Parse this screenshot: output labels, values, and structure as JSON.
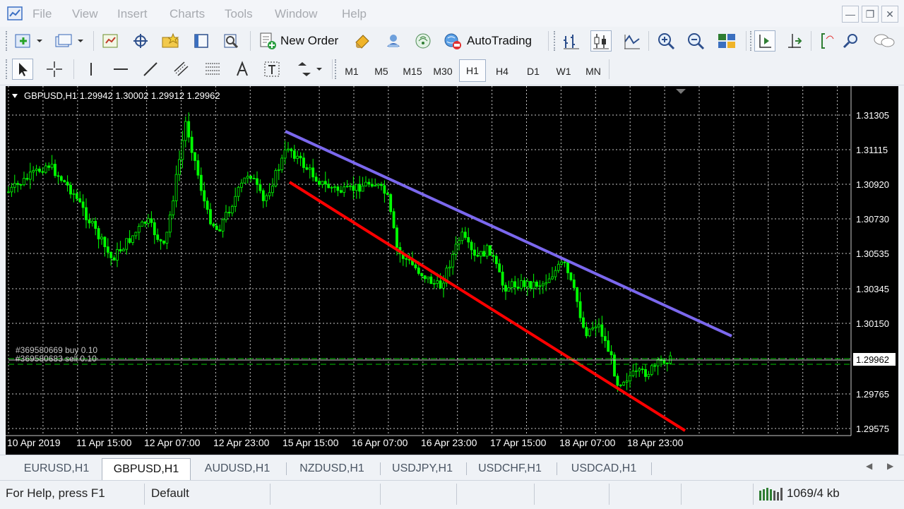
{
  "menubar": {
    "items": [
      "File",
      "View",
      "Insert",
      "Charts",
      "Tools",
      "Window",
      "Help"
    ]
  },
  "toolbar": {
    "new_order": "New Order",
    "auto_trading": "AutoTrading",
    "timeframes": [
      "M1",
      "M5",
      "M15",
      "M30",
      "H1",
      "H4",
      "D1",
      "W1",
      "MN"
    ],
    "active_timeframe": "H1"
  },
  "chart": {
    "header": "GBPUSD,H1  1.29942 1.30002 1.29912 1.29962",
    "price_labels": [
      "1.31305",
      "1.31115",
      "1.30920",
      "1.30730",
      "1.30535",
      "1.30345",
      "1.30150",
      "1.29962",
      "1.29765",
      "1.29575"
    ],
    "current_price": "1.29962",
    "time_labels": [
      "10 Apr 2019",
      "11 Apr 15:00",
      "12 Apr 07:00",
      "12 Apr 23:00",
      "15 Apr 15:00",
      "16 Apr 07:00",
      "16 Apr 23:00",
      "17 Apr 15:00",
      "18 Apr 07:00",
      "18 Apr 23:00"
    ],
    "orders": [
      "#369580669 buy 0.10",
      "#369580683 sell 0.10"
    ],
    "colors": {
      "background": "#000000",
      "candles": "#00ff00",
      "grid": "#c8c8c8",
      "upper_trendline": "#7b68ee",
      "lower_trendline": "#ff0000"
    }
  },
  "tabs": [
    "EURUSD,H1",
    "GBPUSD,H1",
    "AUDUSD,H1",
    "NZDUSD,H1",
    "USDJPY,H1",
    "USDCHF,H1",
    "USDCAD,H1"
  ],
  "active_tab": "GBPUSD,H1",
  "status": {
    "help": "For Help, press F1",
    "profile": "Default",
    "traffic": "1069/4 kb"
  }
}
